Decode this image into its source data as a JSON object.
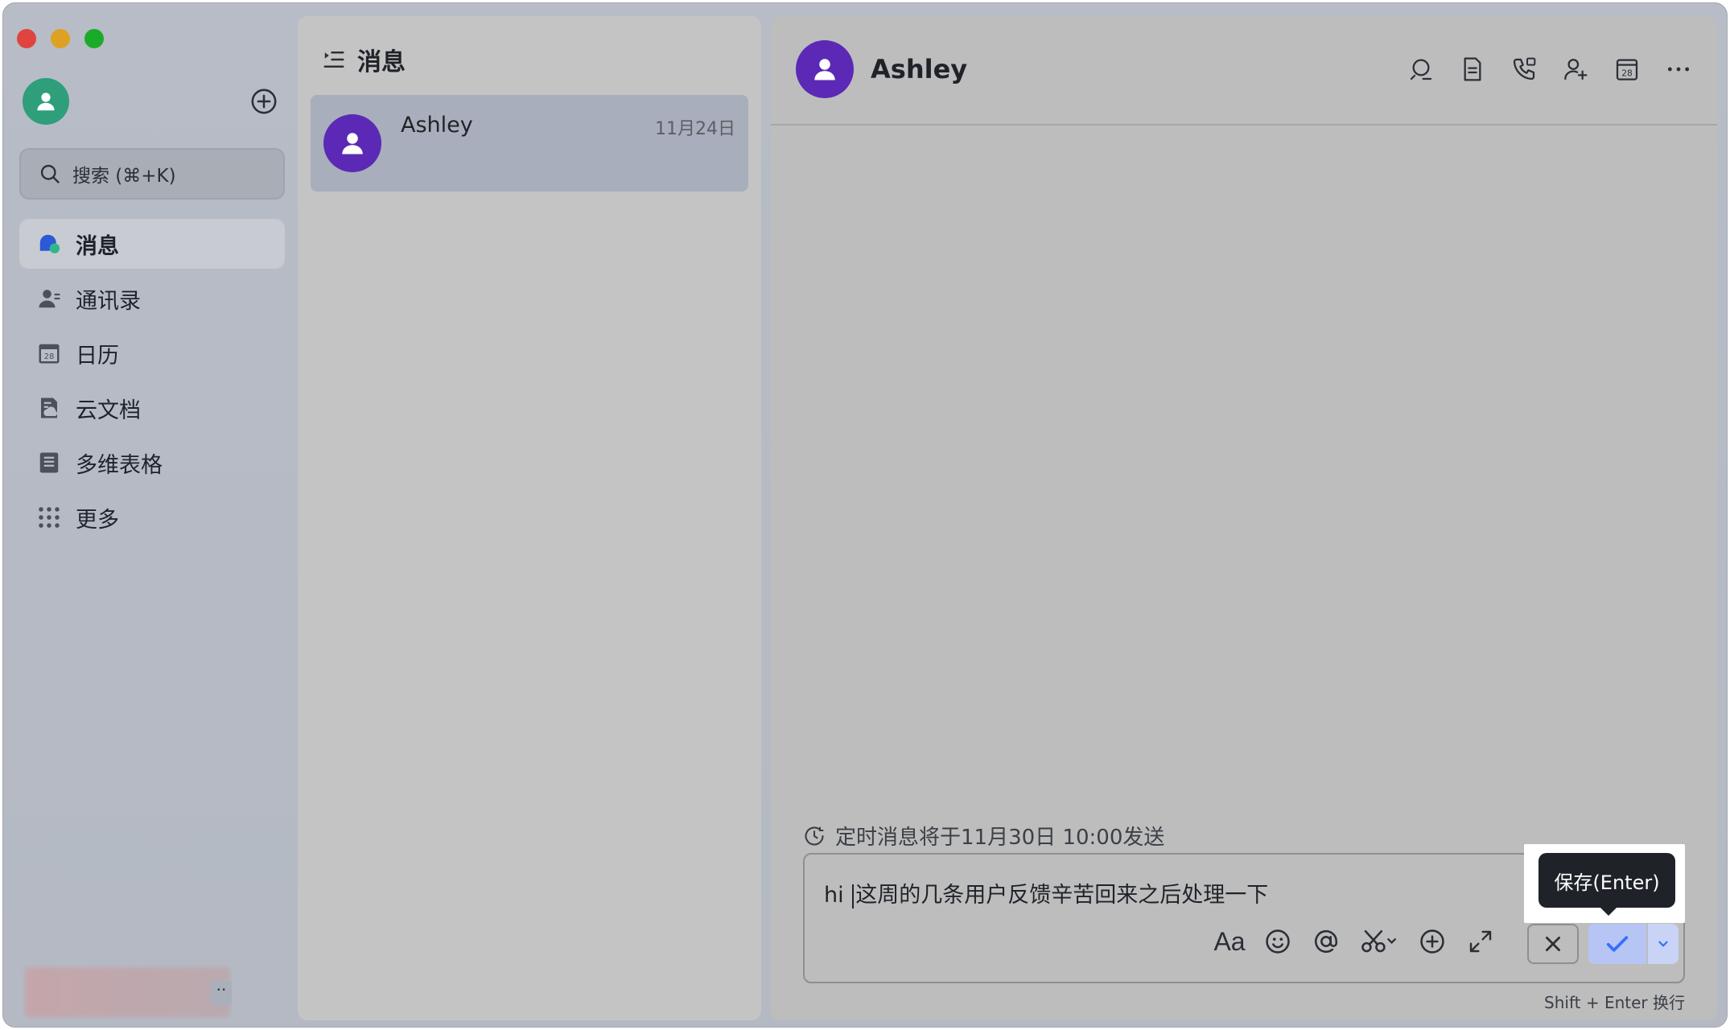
{
  "sidebar": {
    "search_placeholder": "搜索 (⌘+K)",
    "items": [
      {
        "label": "消息",
        "icon": "chat-bubble-icon"
      },
      {
        "label": "通讯录",
        "icon": "contacts-icon"
      },
      {
        "label": "日历",
        "icon": "calendar-icon"
      },
      {
        "label": "云文档",
        "icon": "cloud-doc-icon"
      },
      {
        "label": "多维表格",
        "icon": "table-icon"
      },
      {
        "label": "更多",
        "icon": "grid-dots-icon"
      }
    ],
    "calendar_day": "28"
  },
  "message_list": {
    "title": "消息",
    "conversations": [
      {
        "name": "Ashley",
        "date": "11月24日"
      }
    ]
  },
  "chat": {
    "contact_name": "Ashley",
    "header_tools": [
      "search-icon",
      "document-icon",
      "phone-icon",
      "add-member-icon",
      "calendar-icon",
      "more-icon"
    ],
    "calendar_day": "28",
    "schedule_notice": "定时消息将于11月30日 10:00发送",
    "composer": {
      "text_before_caret": "hi ",
      "text_after_caret": "这周的几条用户反馈辛苦回来之后处理一下",
      "format_label": "Aa",
      "tooltip": "保存(Enter)",
      "hint": "Shift + Enter 换行"
    }
  },
  "colors": {
    "avatar_user": "#2e9e7b",
    "avatar_contact": "#5b29b6",
    "confirm_accent": "#3370ff"
  }
}
